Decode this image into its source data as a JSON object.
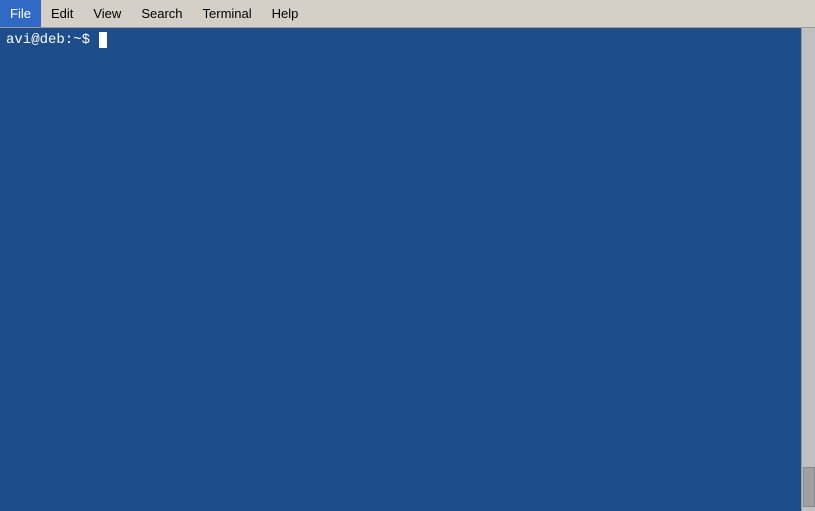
{
  "menubar": {
    "items": [
      {
        "id": "file",
        "label": "File"
      },
      {
        "id": "edit",
        "label": "Edit"
      },
      {
        "id": "view",
        "label": "View"
      },
      {
        "id": "search",
        "label": "Search"
      },
      {
        "id": "terminal",
        "label": "Terminal"
      },
      {
        "id": "help",
        "label": "Help"
      }
    ]
  },
  "terminal": {
    "prompt": "avi@deb:~$ "
  }
}
